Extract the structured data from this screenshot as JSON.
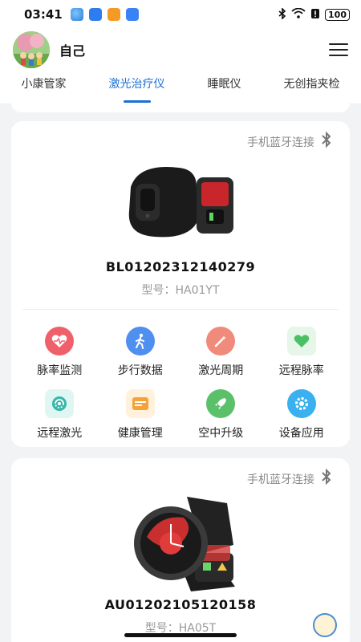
{
  "status_bar": {
    "time": "03:41",
    "battery": "100",
    "app_icons": [
      "weather-app-icon",
      "blue-app-icon",
      "orange-app-icon",
      "mail-app-icon"
    ]
  },
  "header": {
    "user_name": "自己"
  },
  "tabs": [
    {
      "label": "小康管家",
      "active": false
    },
    {
      "label": "激光治疗仪",
      "active": true
    },
    {
      "label": "睡眠仪",
      "active": false
    },
    {
      "label": "无创指夹检",
      "active": false
    }
  ],
  "devices": [
    {
      "connection_label": "手机蓝牙连接",
      "serial": "BL01202312140279",
      "model": "型号：HA01YT",
      "features": [
        {
          "label": "脉率监测",
          "icon": "heart-pulse-icon",
          "color": "#f0606a"
        },
        {
          "label": "步行数据",
          "icon": "walking-icon",
          "color": "#4f8ff0"
        },
        {
          "label": "激光周期",
          "icon": "laser-wand-icon",
          "color": "#f08a7a"
        },
        {
          "label": "远程脉率",
          "icon": "remote-heart-icon",
          "color": "#4bbf63"
        },
        {
          "label": "远程激光",
          "icon": "remote-laser-icon",
          "color": "#36b7a8"
        },
        {
          "label": "健康管理",
          "icon": "health-card-icon",
          "color": "#f5a23a"
        },
        {
          "label": "空中升级",
          "icon": "rocket-icon",
          "color": "#5bc06a"
        },
        {
          "label": "设备应用",
          "icon": "app-gear-icon",
          "color": "#3ab0ee"
        }
      ]
    },
    {
      "connection_label": "手机蓝牙连接",
      "serial": "AU01202105120158",
      "model": "型号：HA05T"
    }
  ],
  "colors": {
    "accent": "#1c6fd4",
    "background": "#f2f3f5"
  }
}
